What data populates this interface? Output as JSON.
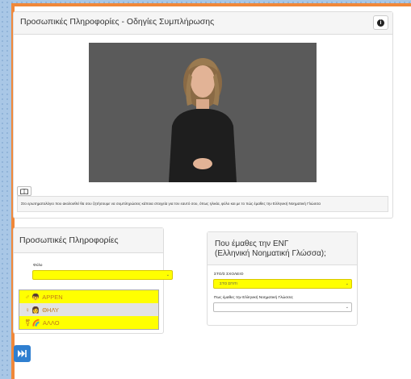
{
  "top_panel": {
    "title": "Προσωπικές Πληροφορίες - Οδηγίες Συμπλήρωσης",
    "info_icon": "info-circle-icon",
    "book_icon": "book-icon",
    "instruction": "Στο ερωτηματολόγιο που ακολουθεί θα σου ζητήσουμε να συμπληρώσεις κάποια στοιχεία για τον εαυτό σου, όπως ηλικία, φύλο και με το πώς έμαθες την Ελληνική Νοηματική Γλώσσα"
  },
  "personal_info": {
    "title": "Προσωπικές Πληροφορίες",
    "gender_label": "Φύλο",
    "gender_value": "",
    "options": [
      {
        "label": "ΑΡΡΕΝ",
        "icons": "♂ 👦"
      },
      {
        "label": "ΘΗΛΥ",
        "icons": "♀ 👩"
      },
      {
        "label": "ΑΛΛΟ",
        "icons": "⚧ 🌈"
      }
    ],
    "highlighted_option": 1
  },
  "learned_panel": {
    "title_line1": "Που έμαθες την ΕΝΓ",
    "title_line2": "(Ελληνική Νοηματική Γλώσσα);",
    "school_label": "ΣΤΟ/Σ ΣΧΟΛΕΙΟ",
    "school_value": "ΣΤΟ ΣΠΙΤΙ",
    "how_label": "Πως έμαθες την Ελληνική Νοηματική Γλώσσα;",
    "how_value": ""
  },
  "nav": {
    "next_icon": "fast-forward-icon"
  },
  "colors": {
    "accent": "#2f7fd0",
    "frame": "#f0883a",
    "highlight": "#ffff00"
  }
}
